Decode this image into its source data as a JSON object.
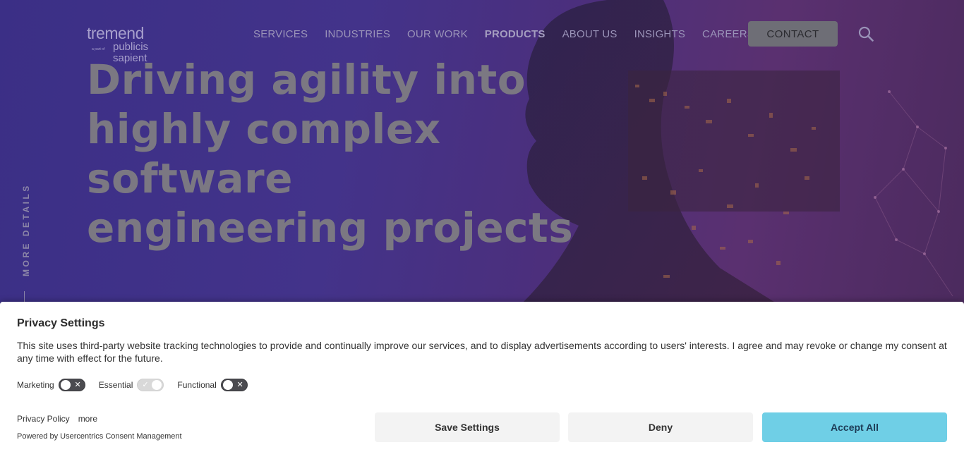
{
  "header": {
    "logo": {
      "main": "tremend",
      "tiny": "a part of",
      "sub_line1": "publicis",
      "sub_line2": "sapient"
    },
    "nav": [
      {
        "label": "SERVICES"
      },
      {
        "label": "INDUSTRIES"
      },
      {
        "label": "OUR WORK"
      },
      {
        "label": "PRODUCTS"
      },
      {
        "label": "ABOUT US"
      },
      {
        "label": "INSIGHTS"
      },
      {
        "label": "CAREERS"
      }
    ],
    "contact_label": "CONTACT",
    "search_icon": "search-icon"
  },
  "hero": {
    "headline_lines": [
      "Driving agility into",
      "highly complex",
      "software",
      "engineering projects"
    ],
    "more_details": "MORE DETAILS"
  },
  "consent": {
    "title": "Privacy Settings",
    "text": "This site uses third-party website tracking technologies to provide and continually improve our services, and to display advertisements according to users' interests. I agree and may revoke or change my consent at any time with effect for the future.",
    "toggles": [
      {
        "label": "Marketing",
        "state": "off"
      },
      {
        "label": "Essential",
        "state": "on-disabled"
      },
      {
        "label": "Functional",
        "state": "off"
      }
    ],
    "links": {
      "privacy_policy": "Privacy Policy",
      "more": "more"
    },
    "powered_by": "Powered by Usercentrics Consent Management",
    "buttons": {
      "save": "Save Settings",
      "deny": "Deny",
      "accept": "Accept All"
    },
    "colors": {
      "accept_bg": "#6fcfe6",
      "button_bg": "#f3f3f3"
    }
  }
}
